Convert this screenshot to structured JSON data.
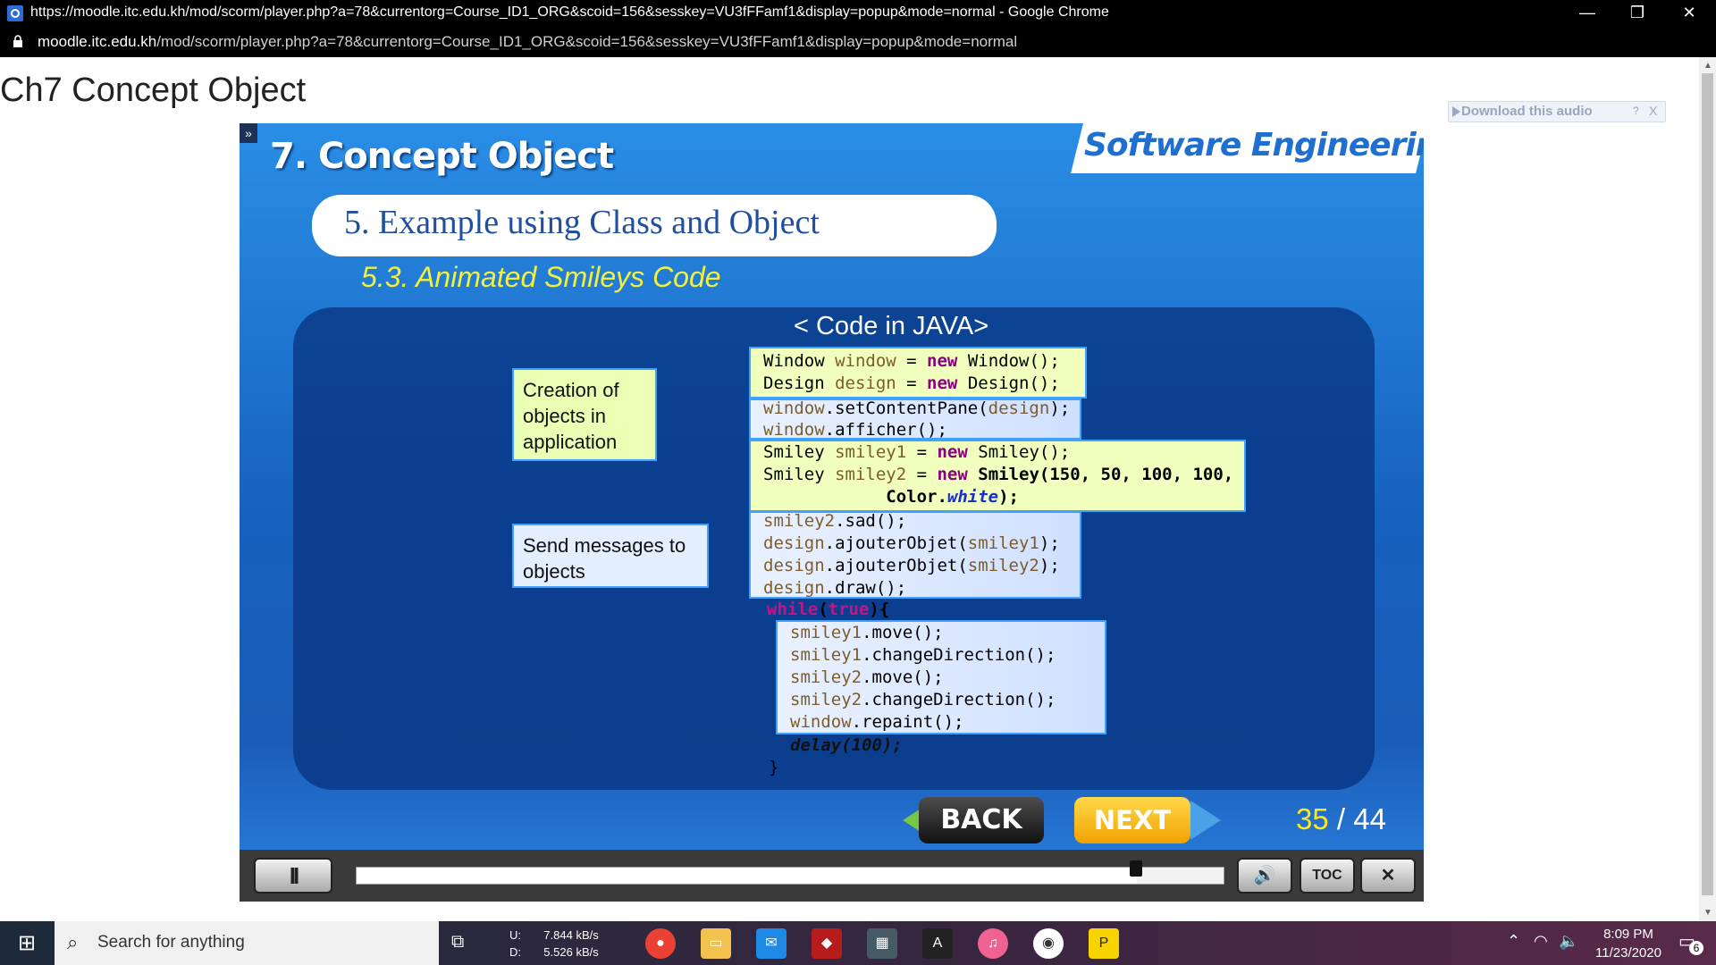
{
  "window": {
    "title": "https://moodle.itc.edu.kh/mod/scorm/player.php?a=78&currentorg=Course_ID1_ORG&scoid=156&sesskey=VU3fFFamf1&display=popup&mode=normal - Google Chrome",
    "minimize": "—",
    "restore": "❐",
    "close": "✕"
  },
  "address": {
    "host": "moodle.itc.edu.kh",
    "path": "/mod/scorm/player.php?a=78&currentorg=Course_ID1_ORG&scoid=156&sesskey=VU3fFFamf1&display=popup&mode=normal",
    "icon": "lock-icon"
  },
  "page": {
    "title": "Ch7 Concept Object",
    "download_label": "Download this audio",
    "download_help": "?",
    "download_close": "X"
  },
  "slide": {
    "toggle": "»",
    "title": "7. Concept Object",
    "brand": "Software Engineering",
    "heading": "5. Example using Class and Object",
    "subheading": "5.3. Animated Smileys Code",
    "code_heading": "< Code in JAVA>",
    "notes": {
      "creation": "Creation of objects in application",
      "messages": "Send messages to objects"
    },
    "code": {
      "l1": [
        "Window ",
        "window",
        " = ",
        "new",
        " Window();"
      ],
      "l2": [
        "Design ",
        "design",
        " = ",
        "new",
        " Design();"
      ],
      "l3": [
        "window",
        ".setContentPane(",
        "design",
        ");"
      ],
      "l4": [
        "window",
        ".afficher();"
      ],
      "l5": [
        "Smiley ",
        "smiley1",
        " = ",
        "new",
        " Smiley();"
      ],
      "l6": [
        "Smiley ",
        "smiley2",
        " = ",
        "new",
        " Smiley(150, 50, 100, 100,"
      ],
      "l7": [
        "            Color.",
        "white",
        ");"
      ],
      "l8": [
        "smiley2",
        ".sad();"
      ],
      "l9": [
        "design",
        ".ajouterObjet(",
        "smiley1",
        ");"
      ],
      "l10": [
        "design",
        ".ajouterObjet(",
        "smiley2",
        ");"
      ],
      "l11": [
        "design",
        ".draw();"
      ],
      "l12": [
        "while",
        "(",
        "true",
        "){"
      ],
      "l13": [
        "smiley1",
        ".move();"
      ],
      "l14": [
        "smiley1",
        ".changeDirection();"
      ],
      "l15": [
        "smiley2",
        ".move();"
      ],
      "l16": [
        "smiley2",
        ".changeDirection();"
      ],
      "l17": [
        "window",
        ".repaint();"
      ],
      "l18": "delay(100);",
      "l19": "}"
    },
    "back_label": "BACK",
    "next_label": "NEXT",
    "page_current": "35",
    "page_total": " / 44"
  },
  "player": {
    "pause_label": "II",
    "progress": 0.9,
    "volume_icon": "🔊",
    "toc_label": "TOC",
    "close_label": "✕"
  },
  "taskbar": {
    "search_placeholder": "Search for anything",
    "net_up_label": "U:",
    "net_up": "7.844 kB/s",
    "net_down_label": "D:",
    "net_down": "5.526 kB/s",
    "time": "8:09 PM",
    "date": "11/23/2020",
    "notifications": "6"
  },
  "colors": {
    "slide_blue": "#1661bd",
    "accent_yellow": "#f3f03b",
    "keyword": "#8b0080",
    "variable": "#7d5c2c"
  }
}
